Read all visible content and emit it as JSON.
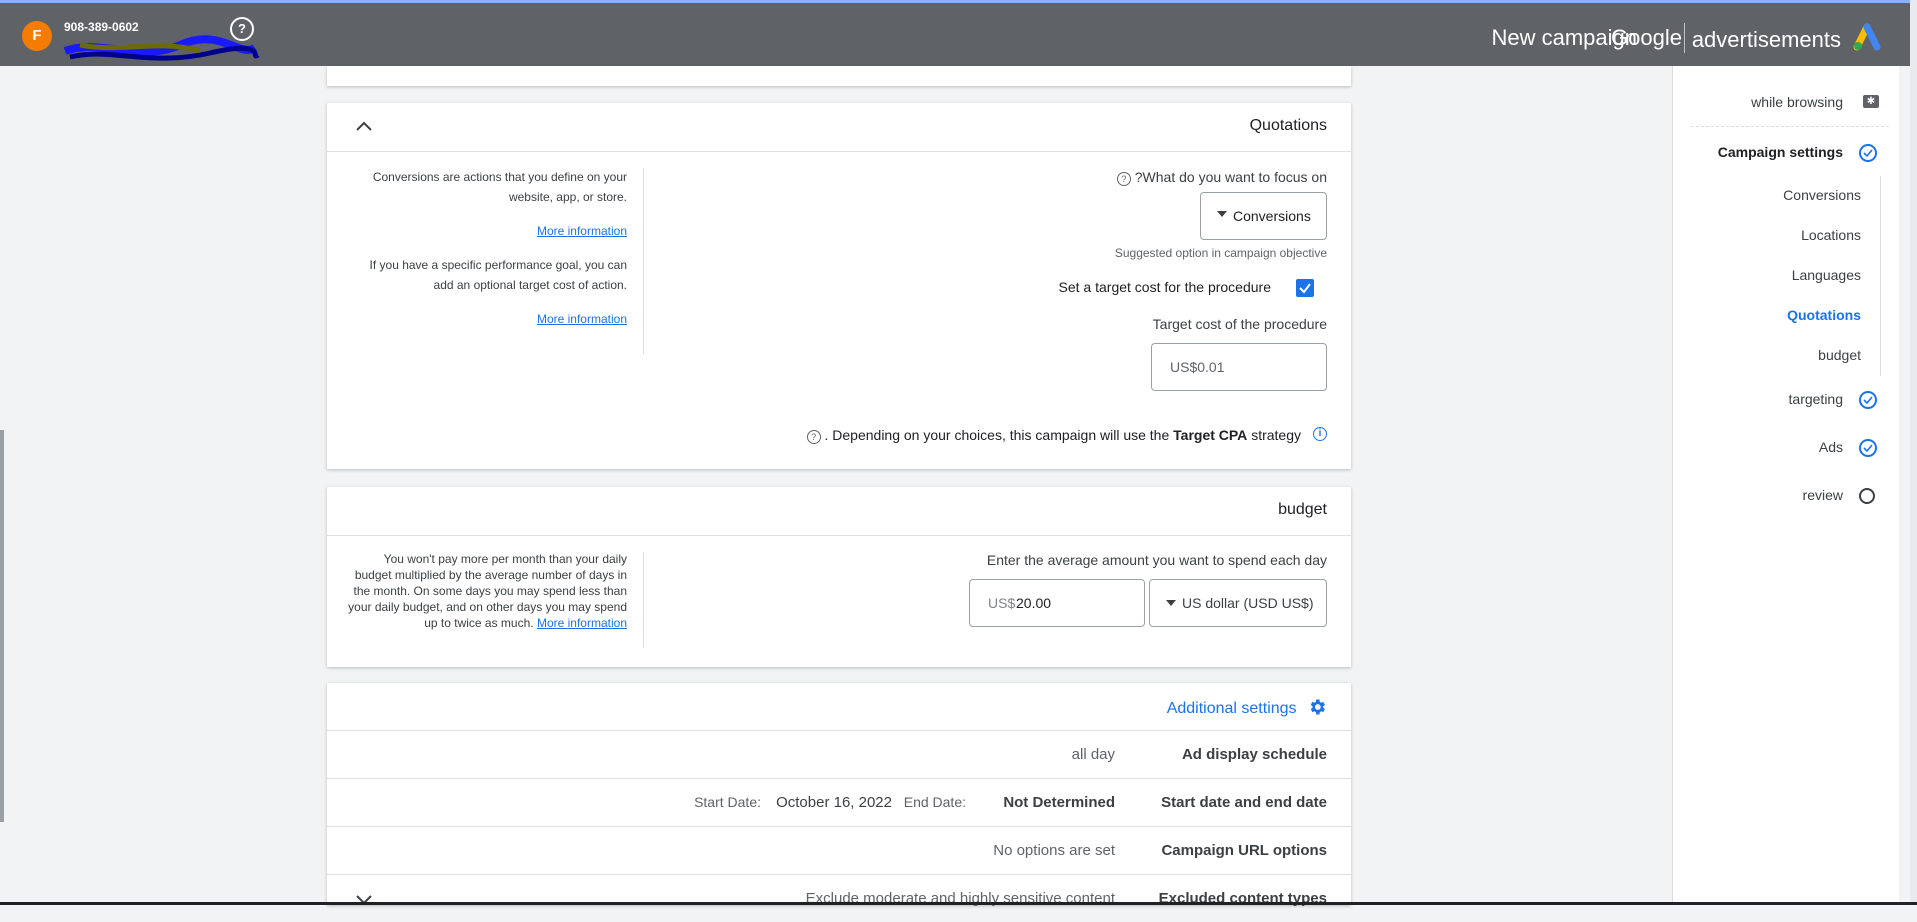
{
  "topbar": {
    "avatar_letter": "F",
    "phone": "908-389-0602",
    "title": "New campaign",
    "brand_google": "Google",
    "brand_ads": "advertisements"
  },
  "bidding": {
    "title": "Quotations",
    "help_text_1": "Conversions are actions that you define on your website, app, or store.",
    "more_info_1": "More information",
    "help_text_2": "If you have a specific performance goal, you can add an optional target cost of action.",
    "more_info_2": "More information",
    "focus_label": "?What do you want to focus on",
    "focus_value": "Conversions",
    "focus_hint": "Suggested option in campaign objective",
    "target_cost_checkbox_label": "Set a target cost for the procedure",
    "target_cost_label": "Target cost of the procedure",
    "target_cost_value": "US$0.01",
    "strategy_text_pre": ". Depending on your choices, this campaign will use the",
    "strategy_bold": "Target CPA",
    "strategy_text_post": "strategy"
  },
  "budget": {
    "title": "budget",
    "help_text": "You won't pay more per month than your daily budget multiplied by the average number of days in the month. On some days you may spend less than your daily budget, and on other days you may spend up to twice as much.",
    "more_info": "More information",
    "amount_label": "Enter the average amount you want to spend each day",
    "currency_prefix": "US$",
    "amount_value": "20.00",
    "currency_select": "US dollar (USD US$)"
  },
  "additional": {
    "title": "Additional settings",
    "rows": [
      {
        "label": "Ad display schedule",
        "value": "all day"
      },
      {
        "label": "Start date and end date",
        "start_label": "Start Date:",
        "start_value": "October 16, 2022",
        "end_label": "End Date:",
        "end_value": "Not Determined"
      },
      {
        "label": "Campaign URL options",
        "value": "No options are set"
      },
      {
        "label": "Excluded content types",
        "value": "Exclude moderate and highly sensitive content"
      }
    ]
  },
  "sidebar": {
    "items": [
      {
        "label": "while browsing"
      },
      {
        "label": "Campaign settings"
      },
      {
        "label": "Conversions"
      },
      {
        "label": "Locations"
      },
      {
        "label": "Languages"
      },
      {
        "label": "Quotations"
      },
      {
        "label": "budget"
      },
      {
        "label": "targeting"
      },
      {
        "label": "Ads"
      },
      {
        "label": "review"
      }
    ]
  },
  "colors": {
    "accent": "#1a73e8",
    "topbar": "#5f6368",
    "avatar": "#f57c00"
  }
}
